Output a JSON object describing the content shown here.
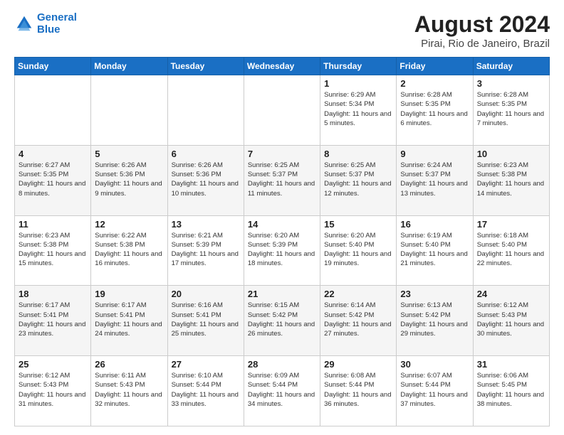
{
  "logo": {
    "line1": "General",
    "line2": "Blue"
  },
  "title": "August 2024",
  "subtitle": "Pirai, Rio de Janeiro, Brazil",
  "days_of_week": [
    "Sunday",
    "Monday",
    "Tuesday",
    "Wednesday",
    "Thursday",
    "Friday",
    "Saturday"
  ],
  "weeks": [
    [
      {
        "day": "",
        "info": ""
      },
      {
        "day": "",
        "info": ""
      },
      {
        "day": "",
        "info": ""
      },
      {
        "day": "",
        "info": ""
      },
      {
        "day": "1",
        "info": "Sunrise: 6:29 AM\nSunset: 5:34 PM\nDaylight: 11 hours and 5 minutes."
      },
      {
        "day": "2",
        "info": "Sunrise: 6:28 AM\nSunset: 5:35 PM\nDaylight: 11 hours and 6 minutes."
      },
      {
        "day": "3",
        "info": "Sunrise: 6:28 AM\nSunset: 5:35 PM\nDaylight: 11 hours and 7 minutes."
      }
    ],
    [
      {
        "day": "4",
        "info": "Sunrise: 6:27 AM\nSunset: 5:35 PM\nDaylight: 11 hours and 8 minutes."
      },
      {
        "day": "5",
        "info": "Sunrise: 6:26 AM\nSunset: 5:36 PM\nDaylight: 11 hours and 9 minutes."
      },
      {
        "day": "6",
        "info": "Sunrise: 6:26 AM\nSunset: 5:36 PM\nDaylight: 11 hours and 10 minutes."
      },
      {
        "day": "7",
        "info": "Sunrise: 6:25 AM\nSunset: 5:37 PM\nDaylight: 11 hours and 11 minutes."
      },
      {
        "day": "8",
        "info": "Sunrise: 6:25 AM\nSunset: 5:37 PM\nDaylight: 11 hours and 12 minutes."
      },
      {
        "day": "9",
        "info": "Sunrise: 6:24 AM\nSunset: 5:37 PM\nDaylight: 11 hours and 13 minutes."
      },
      {
        "day": "10",
        "info": "Sunrise: 6:23 AM\nSunset: 5:38 PM\nDaylight: 11 hours and 14 minutes."
      }
    ],
    [
      {
        "day": "11",
        "info": "Sunrise: 6:23 AM\nSunset: 5:38 PM\nDaylight: 11 hours and 15 minutes."
      },
      {
        "day": "12",
        "info": "Sunrise: 6:22 AM\nSunset: 5:38 PM\nDaylight: 11 hours and 16 minutes."
      },
      {
        "day": "13",
        "info": "Sunrise: 6:21 AM\nSunset: 5:39 PM\nDaylight: 11 hours and 17 minutes."
      },
      {
        "day": "14",
        "info": "Sunrise: 6:20 AM\nSunset: 5:39 PM\nDaylight: 11 hours and 18 minutes."
      },
      {
        "day": "15",
        "info": "Sunrise: 6:20 AM\nSunset: 5:40 PM\nDaylight: 11 hours and 19 minutes."
      },
      {
        "day": "16",
        "info": "Sunrise: 6:19 AM\nSunset: 5:40 PM\nDaylight: 11 hours and 21 minutes."
      },
      {
        "day": "17",
        "info": "Sunrise: 6:18 AM\nSunset: 5:40 PM\nDaylight: 11 hours and 22 minutes."
      }
    ],
    [
      {
        "day": "18",
        "info": "Sunrise: 6:17 AM\nSunset: 5:41 PM\nDaylight: 11 hours and 23 minutes."
      },
      {
        "day": "19",
        "info": "Sunrise: 6:17 AM\nSunset: 5:41 PM\nDaylight: 11 hours and 24 minutes."
      },
      {
        "day": "20",
        "info": "Sunrise: 6:16 AM\nSunset: 5:41 PM\nDaylight: 11 hours and 25 minutes."
      },
      {
        "day": "21",
        "info": "Sunrise: 6:15 AM\nSunset: 5:42 PM\nDaylight: 11 hours and 26 minutes."
      },
      {
        "day": "22",
        "info": "Sunrise: 6:14 AM\nSunset: 5:42 PM\nDaylight: 11 hours and 27 minutes."
      },
      {
        "day": "23",
        "info": "Sunrise: 6:13 AM\nSunset: 5:42 PM\nDaylight: 11 hours and 29 minutes."
      },
      {
        "day": "24",
        "info": "Sunrise: 6:12 AM\nSunset: 5:43 PM\nDaylight: 11 hours and 30 minutes."
      }
    ],
    [
      {
        "day": "25",
        "info": "Sunrise: 6:12 AM\nSunset: 5:43 PM\nDaylight: 11 hours and 31 minutes."
      },
      {
        "day": "26",
        "info": "Sunrise: 6:11 AM\nSunset: 5:43 PM\nDaylight: 11 hours and 32 minutes."
      },
      {
        "day": "27",
        "info": "Sunrise: 6:10 AM\nSunset: 5:44 PM\nDaylight: 11 hours and 33 minutes."
      },
      {
        "day": "28",
        "info": "Sunrise: 6:09 AM\nSunset: 5:44 PM\nDaylight: 11 hours and 34 minutes."
      },
      {
        "day": "29",
        "info": "Sunrise: 6:08 AM\nSunset: 5:44 PM\nDaylight: 11 hours and 36 minutes."
      },
      {
        "day": "30",
        "info": "Sunrise: 6:07 AM\nSunset: 5:44 PM\nDaylight: 11 hours and 37 minutes."
      },
      {
        "day": "31",
        "info": "Sunrise: 6:06 AM\nSunset: 5:45 PM\nDaylight: 11 hours and 38 minutes."
      }
    ]
  ]
}
